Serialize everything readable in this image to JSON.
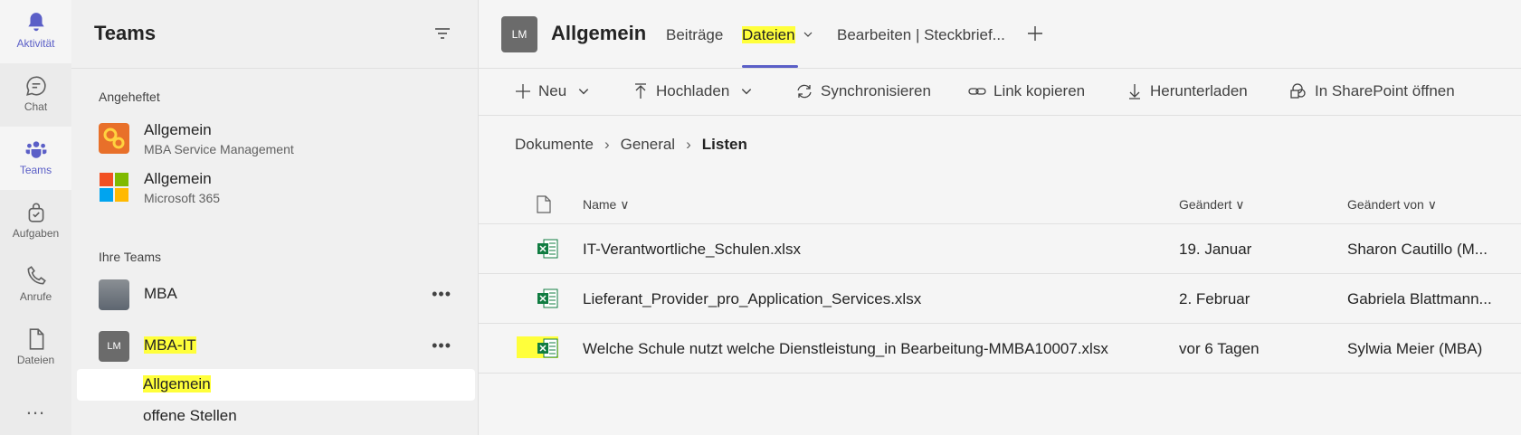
{
  "rail": {
    "activity": "Aktivität",
    "chat": "Chat",
    "teams": "Teams",
    "tasks": "Aufgaben",
    "calls": "Anrufe",
    "files": "Dateien",
    "more": "..."
  },
  "teams_panel": {
    "title": "Teams",
    "pinned_label": "Angeheftet",
    "pinned": [
      {
        "name": "Allgemein",
        "team": "MBA Service Management"
      },
      {
        "name": "Allgemein",
        "team": "Microsoft 365"
      }
    ],
    "your_teams_label": "Ihre Teams",
    "teams": [
      {
        "name": "MBA"
      },
      {
        "name": "MBA-IT",
        "initials": "LM"
      }
    ],
    "channels": [
      "Allgemein",
      "offene Stellen"
    ]
  },
  "channel_header": {
    "initials": "LM",
    "title": "Allgemein",
    "tabs": [
      "Beiträge",
      "Dateien",
      "Bearbeiten | Steckbrief..."
    ]
  },
  "toolbar": {
    "new": "Neu",
    "upload": "Hochladen",
    "sync": "Synchronisieren",
    "copy_link": "Link kopieren",
    "download": "Herunterladen",
    "sharepoint": "In SharePoint öffnen"
  },
  "breadcrumb": [
    "Dokumente",
    "General",
    "Listen"
  ],
  "files_table": {
    "headers": {
      "name": "Name",
      "modified": "Geändert",
      "modified_by": "Geändert von"
    },
    "rows": [
      {
        "name": "IT-Verantwortliche_Schulen.xlsx",
        "modified": "19. Januar",
        "modified_by": "Sharon Cautillo (M..."
      },
      {
        "name": "Lieferant_Provider_pro_Application_Services.xlsx",
        "modified": "2. Februar",
        "modified_by": "Gabriela Blattmann..."
      },
      {
        "name": "Welche Schule nutzt welche Dienstleistung_in Bearbeitung-MMBA10007.xlsx",
        "modified": "vor 6 Tagen",
        "modified_by": "Sylwia Meier (MBA)"
      }
    ]
  },
  "colors": {
    "accent": "#5b5fc7",
    "highlight": "#ffff3b",
    "excel": "#107c41"
  }
}
